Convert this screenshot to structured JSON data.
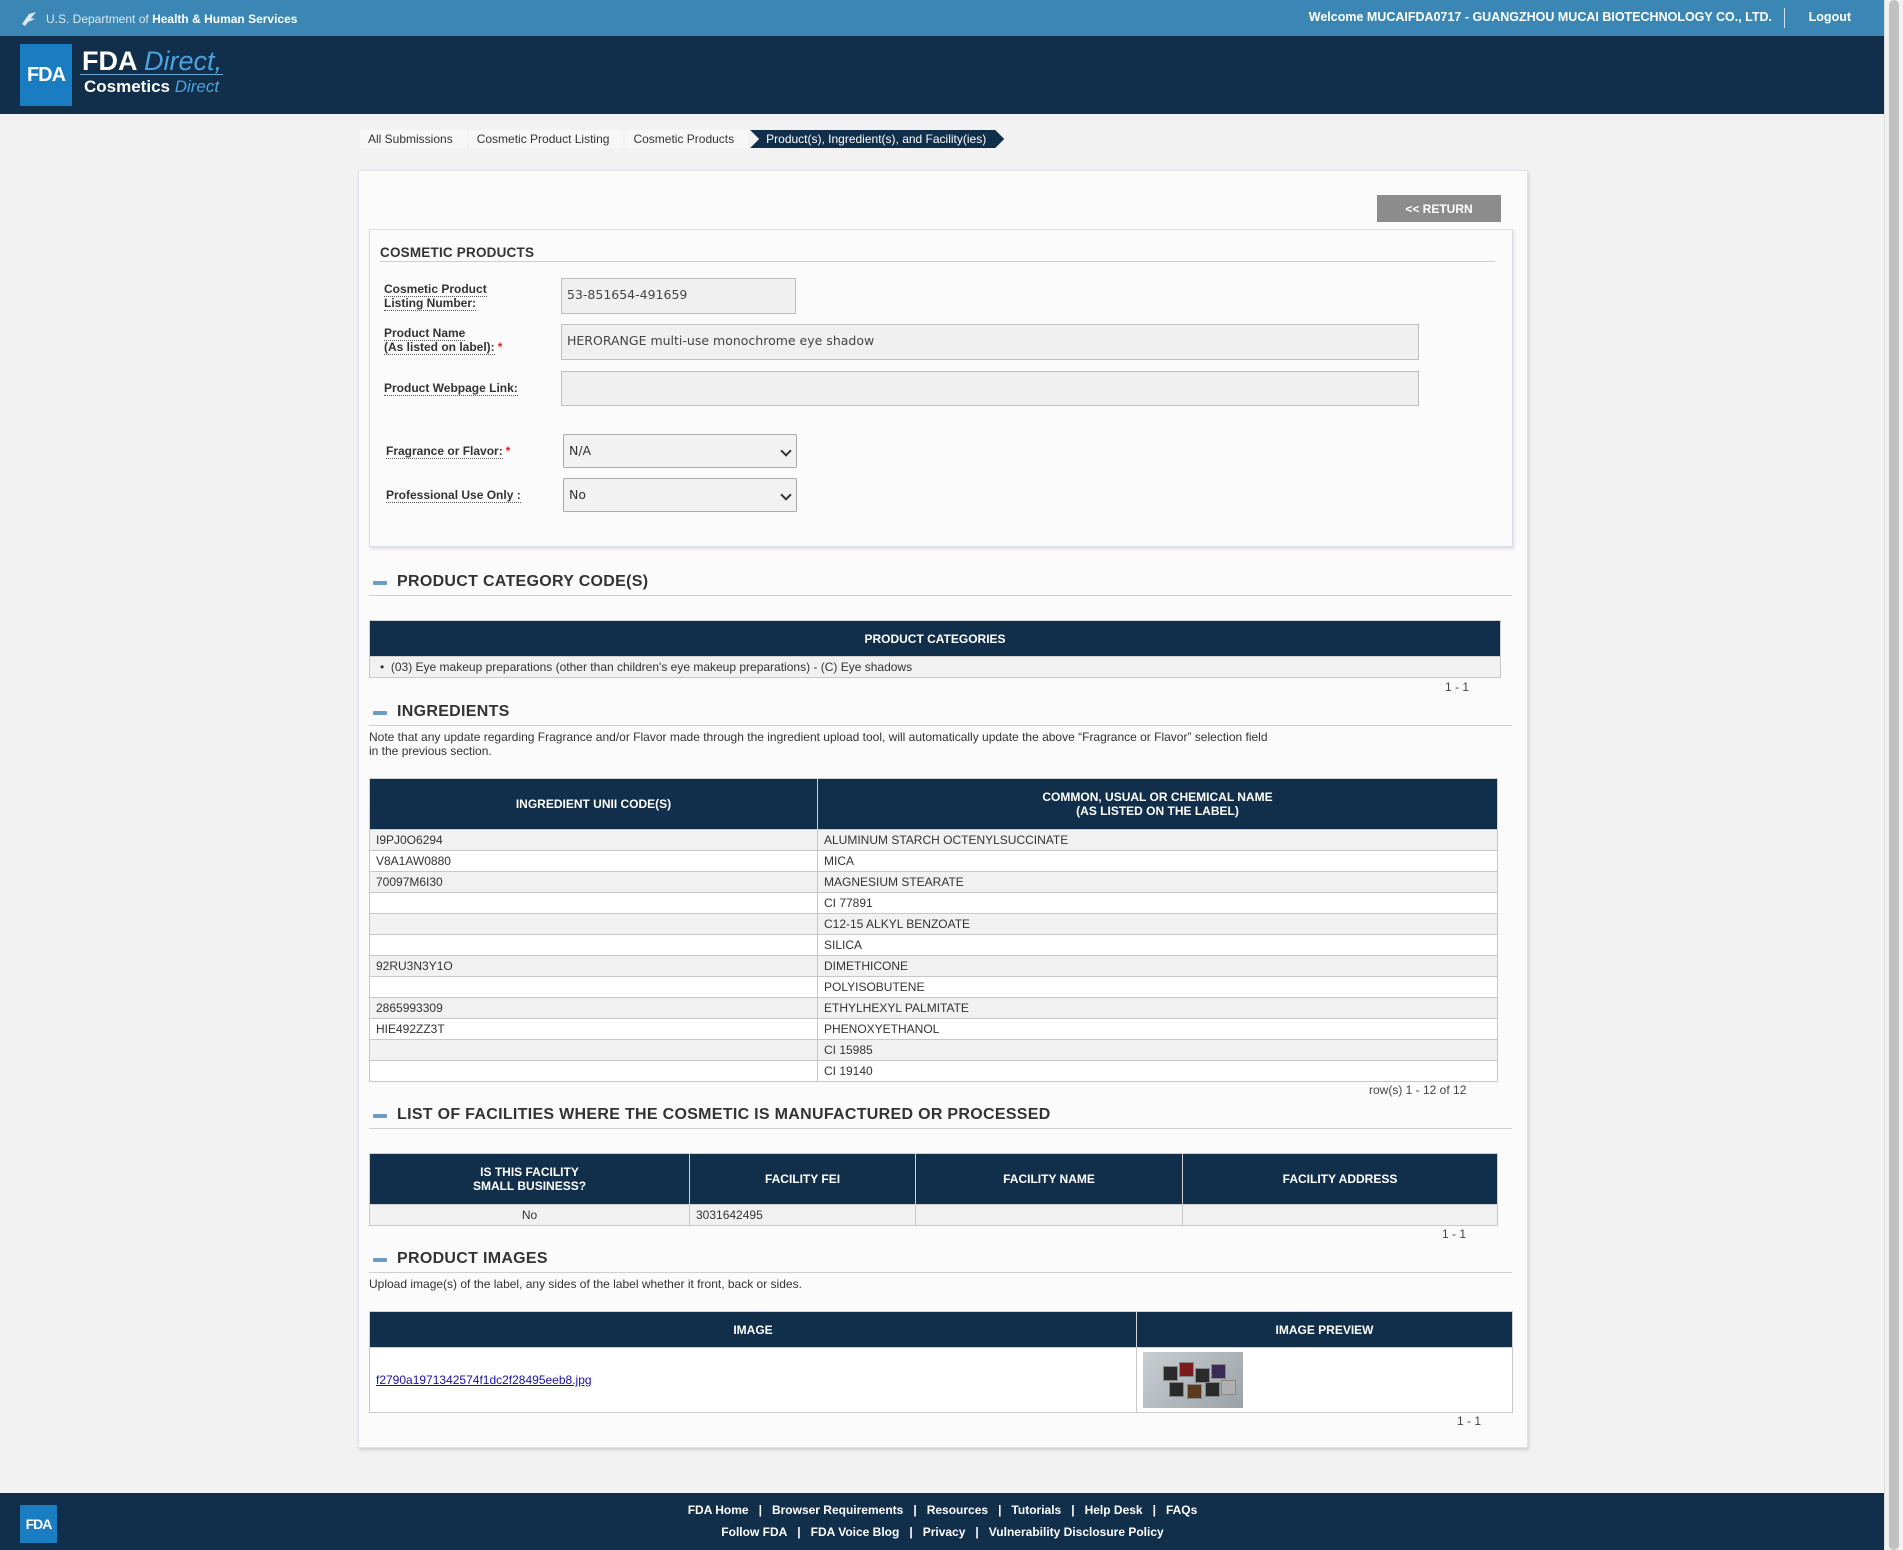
{
  "topbar": {
    "hhs_prefix": "U.S. Department of",
    "hhs_bold": "Health & Human Services",
    "welcome": "Welcome MUCAIFDA0717 - GUANGZHOU MUCAI BIOTECHNOLOGY CO., LTD.",
    "logout": "Logout"
  },
  "brand": {
    "logo": "FDA",
    "line1_a": "FDA",
    "line1_b": "Direct,",
    "line2_a": "Cosmetics",
    "line2_b": "Direct"
  },
  "breadcrumb": [
    "All Submissions",
    "Cosmetic Product Listing",
    "Cosmetic Products",
    "Product(s), Ingredient(s), and Facility(ies)"
  ],
  "return_label": "<< RETURN",
  "cosmetic_products": {
    "title": "COSMETIC PRODUCTS",
    "listing_label_1": "Cosmetic Product",
    "listing_label_2": "Listing Number:",
    "listing_value": "53-851654-491659",
    "name_label_1": "Product Name",
    "name_label_2": "(As listed on label):",
    "name_value": "HERORANGE multi-use monochrome eye shadow",
    "webpage_label": "Product Webpage Link:",
    "webpage_value": "",
    "fragrance_label": "Fragrance or Flavor:",
    "fragrance_value": "N/A",
    "professional_label": "Professional Use Only :",
    "professional_value": "No",
    "required_mark": "*"
  },
  "categories": {
    "title": "PRODUCT CATEGORY CODE(S)",
    "header": "PRODUCT CATEGORIES",
    "items": [
      "(03) Eye makeup preparations (other than children's eye makeup preparations) - (C) Eye shadows"
    ],
    "pager": "1 - 1"
  },
  "ingredients": {
    "title": "INGREDIENTS",
    "note": "Note that any update regarding Fragrance and/or Flavor made through the ingredient upload tool, will automatically update the above “Fragrance or Flavor” selection field in the previous section.",
    "col1": "INGREDIENT UNII CODE(S)",
    "col2_a": "COMMON, USUAL OR CHEMICAL NAME",
    "col2_b": "(AS LISTED ON THE LABEL)",
    "rows": [
      [
        "I9PJ0O6294",
        "ALUMINUM STARCH OCTENYLSUCCINATE"
      ],
      [
        "V8A1AW0880",
        "MICA"
      ],
      [
        "70097M6I30",
        "MAGNESIUM STEARATE"
      ],
      [
        "",
        "CI 77891"
      ],
      [
        "",
        "C12-15 ALKYL BENZOATE"
      ],
      [
        "",
        "SILICA"
      ],
      [
        "92RU3N3Y1O",
        "DIMETHICONE"
      ],
      [
        "",
        "POLYISOBUTENE"
      ],
      [
        "2865993309",
        "ETHYLHEXYL PALMITATE"
      ],
      [
        "HIE492ZZ3T",
        "PHENOXYETHANOL"
      ],
      [
        "",
        "CI 15985"
      ],
      [
        "",
        "CI 19140"
      ]
    ],
    "pager": "row(s) 1 - 12 of 12"
  },
  "facilities": {
    "title": "LIST OF FACILITIES WHERE THE COSMETIC IS MANUFACTURED OR PROCESSED",
    "col1_a": "IS THIS FACILITY",
    "col1_b": "SMALL BUSINESS?",
    "col2": "FACILITY FEI",
    "col3": "FACILITY NAME",
    "col4": "FACILITY ADDRESS",
    "rows": [
      [
        "No",
        "3031642495",
        "",
        ""
      ]
    ],
    "pager": "1 - 1"
  },
  "images": {
    "title": "PRODUCT IMAGES",
    "note": "Upload image(s) of the label, any sides of the label whether it front, back or sides.",
    "col1": "IMAGE",
    "col2": "IMAGE PREVIEW",
    "file": "f2790a1971342574f1dc2f28495eeb8.jpg",
    "pager": "1 - 1"
  },
  "footer": {
    "logo": "FDA",
    "row1": [
      "FDA Home",
      "Browser Requirements",
      "Resources",
      "Tutorials",
      "Help Desk",
      "FAQs"
    ],
    "row2": [
      "Follow FDA",
      "FDA Voice Blog",
      "Privacy",
      "Vulnerability Disclosure Policy"
    ],
    "separator": "|"
  }
}
